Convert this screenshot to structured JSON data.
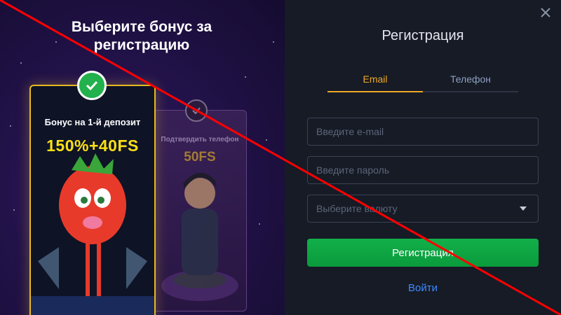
{
  "promo": {
    "title_line1": "Выберите бонус за",
    "title_line2": "регистрацию",
    "cards": [
      {
        "subtitle": "Бонус на 1-й депозит",
        "value": "150%+40FS",
        "selected": true
      },
      {
        "subtitle": "Подтвердить телефон",
        "value": "50FS",
        "selected": false
      }
    ]
  },
  "form": {
    "title": "Регистрация",
    "tabs": [
      {
        "label": "Email",
        "active": true
      },
      {
        "label": "Телефон",
        "active": false
      }
    ],
    "email_placeholder": "Введите e-mail",
    "password_placeholder": "Введите пароль",
    "currency_placeholder": "Выберите валюту",
    "submit_label": "Регистрация",
    "login_label": "Войти"
  },
  "colors": {
    "accent": "#f0a82a",
    "submit": "#12b04a",
    "link": "#3d8bff",
    "overlay_line": "#ff0000",
    "check": "#22b14c"
  },
  "icons": [
    "close-icon",
    "check-icon",
    "chevron-down-icon"
  ]
}
